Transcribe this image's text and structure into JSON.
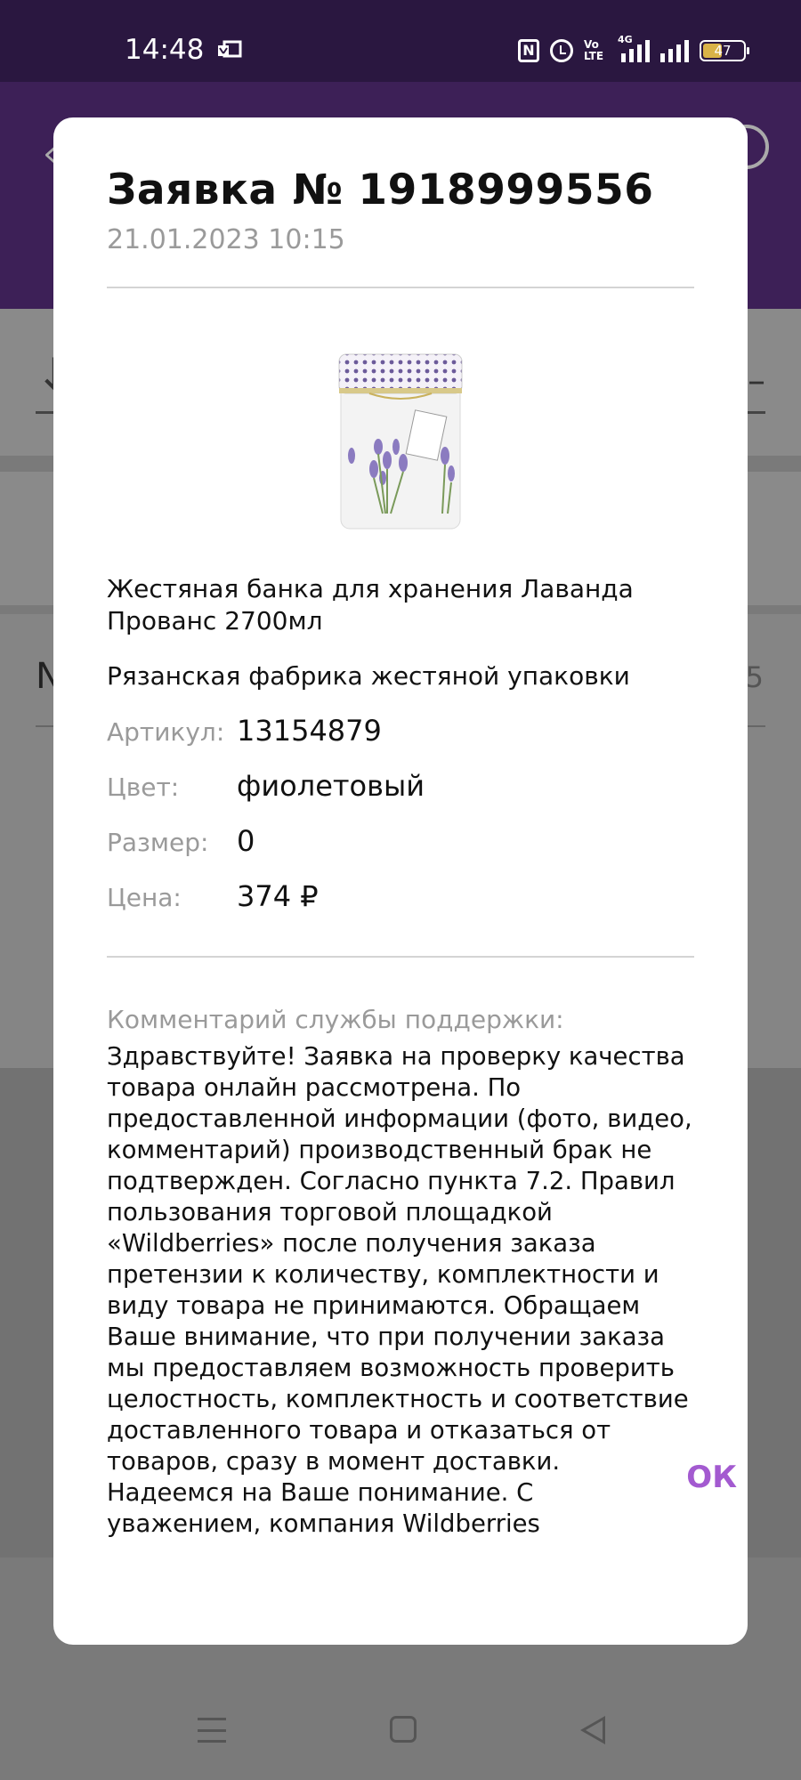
{
  "status_bar": {
    "time": "14:48",
    "battery_level": "47",
    "network": "4G",
    "volte": "Vo\nLTE",
    "nfc": "N"
  },
  "background": {
    "list_letter": "N",
    "list_value": "5"
  },
  "dialog": {
    "title": "Заявка № 1918999556",
    "date": "21.01.2023 10:15",
    "product_name": "Жестяная банка для хранения Лаванда Прованс 2700мл",
    "brand": "Рязанская фабрика жестяной упаковки",
    "properties": [
      {
        "label": "Артикул:",
        "value": "13154879"
      },
      {
        "label": "Цвет:",
        "value": "фиолетовый"
      },
      {
        "label": "Размер:",
        "value": "0"
      },
      {
        "label": "Цена:",
        "value": "374 ₽"
      }
    ],
    "comment_label": "Комментарий службы поддержки:",
    "comment_text": "Здравствуйте! Заявка на проверку качества товара онлайн рассмотрена. По предоставленной информации (фото, видео, комментарий) производственный брак не подтвержден. Согласно пункта 7.2. Правил пользования торговой площадкой «Wildberries» после получения заказа претензии к количеству, комплектности и виду товара не принимаются. Обращаем Ваше внимание, что при получении заказа мы предоставляем возможность проверить целостность, комплектность и соответствие доставленного товара и отказаться от товаров, сразу в момент доставки. Надеемся на Ваше понимание. С уважением, компания Wildberries",
    "ok_label": "ОК"
  },
  "colors": {
    "accent": "#a35ad0",
    "status_bar": "#2a1740",
    "header": "#3d2057"
  }
}
